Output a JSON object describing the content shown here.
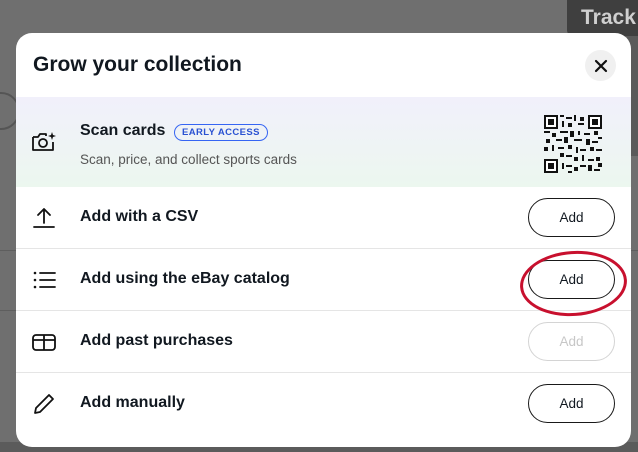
{
  "background": {
    "track_label": "Track"
  },
  "modal": {
    "title": "Grow your collection",
    "close_icon": "close-icon",
    "scan": {
      "title": "Scan cards",
      "badge": "EARLY ACCESS",
      "subtitle": "Scan, price, and collect sports cards",
      "icon": "camera-sparkle-icon",
      "qr": "qr-code"
    },
    "options": [
      {
        "label": "Add with a CSV",
        "icon": "upload-icon",
        "button": "Add",
        "enabled": true
      },
      {
        "label": "Add using the eBay catalog",
        "icon": "list-icon",
        "button": "Add",
        "enabled": true,
        "highlighted": true
      },
      {
        "label": "Add past purchases",
        "icon": "package-icon",
        "button": "Add",
        "enabled": false
      },
      {
        "label": "Add manually",
        "icon": "pencil-icon",
        "button": "Add",
        "enabled": true
      }
    ]
  },
  "colors": {
    "badge_accent": "#3665f3",
    "annotation": "#c8102e",
    "text": "#111820"
  }
}
